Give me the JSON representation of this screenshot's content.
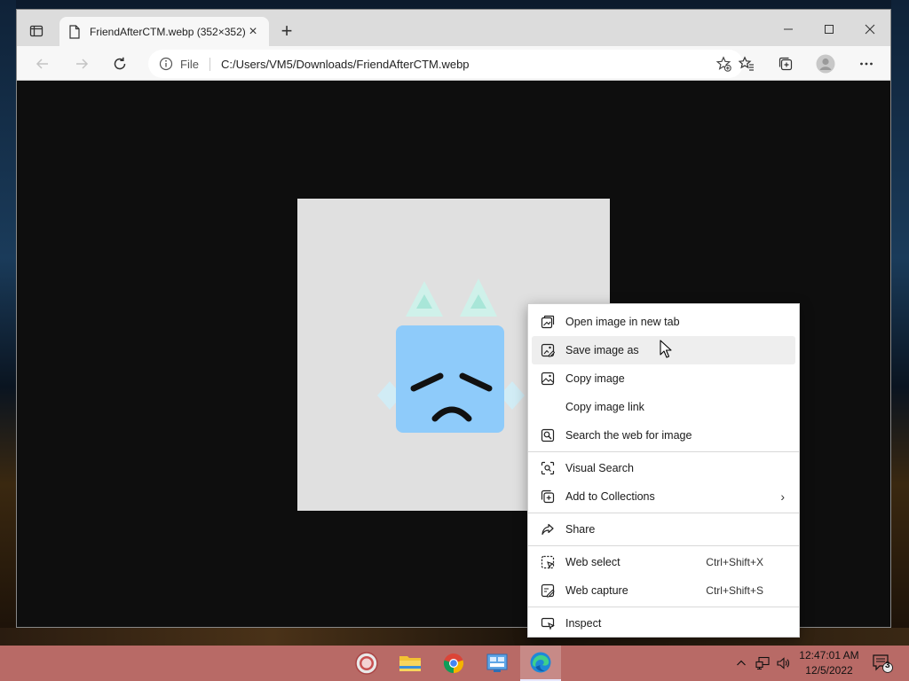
{
  "browser": {
    "tab": {
      "title": "FriendAfterCTM.webp (352×352)",
      "close_glyph": "×"
    },
    "new_tab_glyph": "+",
    "address": {
      "info_label": "File",
      "url": "C:/Users/VM5/Downloads/FriendAfterCTM.webp"
    },
    "window_controls": {
      "minimize": "—",
      "maximize": "☐",
      "close": "✕"
    }
  },
  "context_menu": {
    "items": [
      {
        "label": "Open image in new tab",
        "icon": "open-in-new-tab-icon"
      },
      {
        "label": "Save image as",
        "icon": "save-image-icon",
        "hover": true
      },
      {
        "label": "Copy image",
        "icon": "image-icon"
      },
      {
        "label": "Copy image link",
        "icon": ""
      },
      {
        "label": "Search the web for image",
        "icon": "search-image-icon"
      },
      {
        "label": "Visual Search",
        "icon": "visual-search-icon"
      },
      {
        "label": "Add to Collections",
        "icon": "collections-icon",
        "submenu_glyph": "›"
      },
      {
        "label": "Share",
        "icon": "share-icon"
      },
      {
        "label": "Web select",
        "icon": "web-select-icon",
        "shortcut": "Ctrl+Shift+X"
      },
      {
        "label": "Web capture",
        "icon": "web-capture-icon",
        "shortcut": "Ctrl+Shift+S"
      },
      {
        "label": "Inspect",
        "icon": "inspect-icon"
      }
    ]
  },
  "taskbar": {
    "apps": [
      "app-icon",
      "file-explorer-icon",
      "chrome-icon",
      "control-panel-icon",
      "edge-icon"
    ],
    "active_app": "edge-icon",
    "clock": {
      "time": "12:47:01 AM",
      "date": "12/5/2022"
    },
    "notification_count": "3",
    "color": "#b86a66"
  },
  "image_colors": {
    "background": "#e0e0e0",
    "face": "#8ecbfa",
    "ears": "#c6f2ea"
  }
}
